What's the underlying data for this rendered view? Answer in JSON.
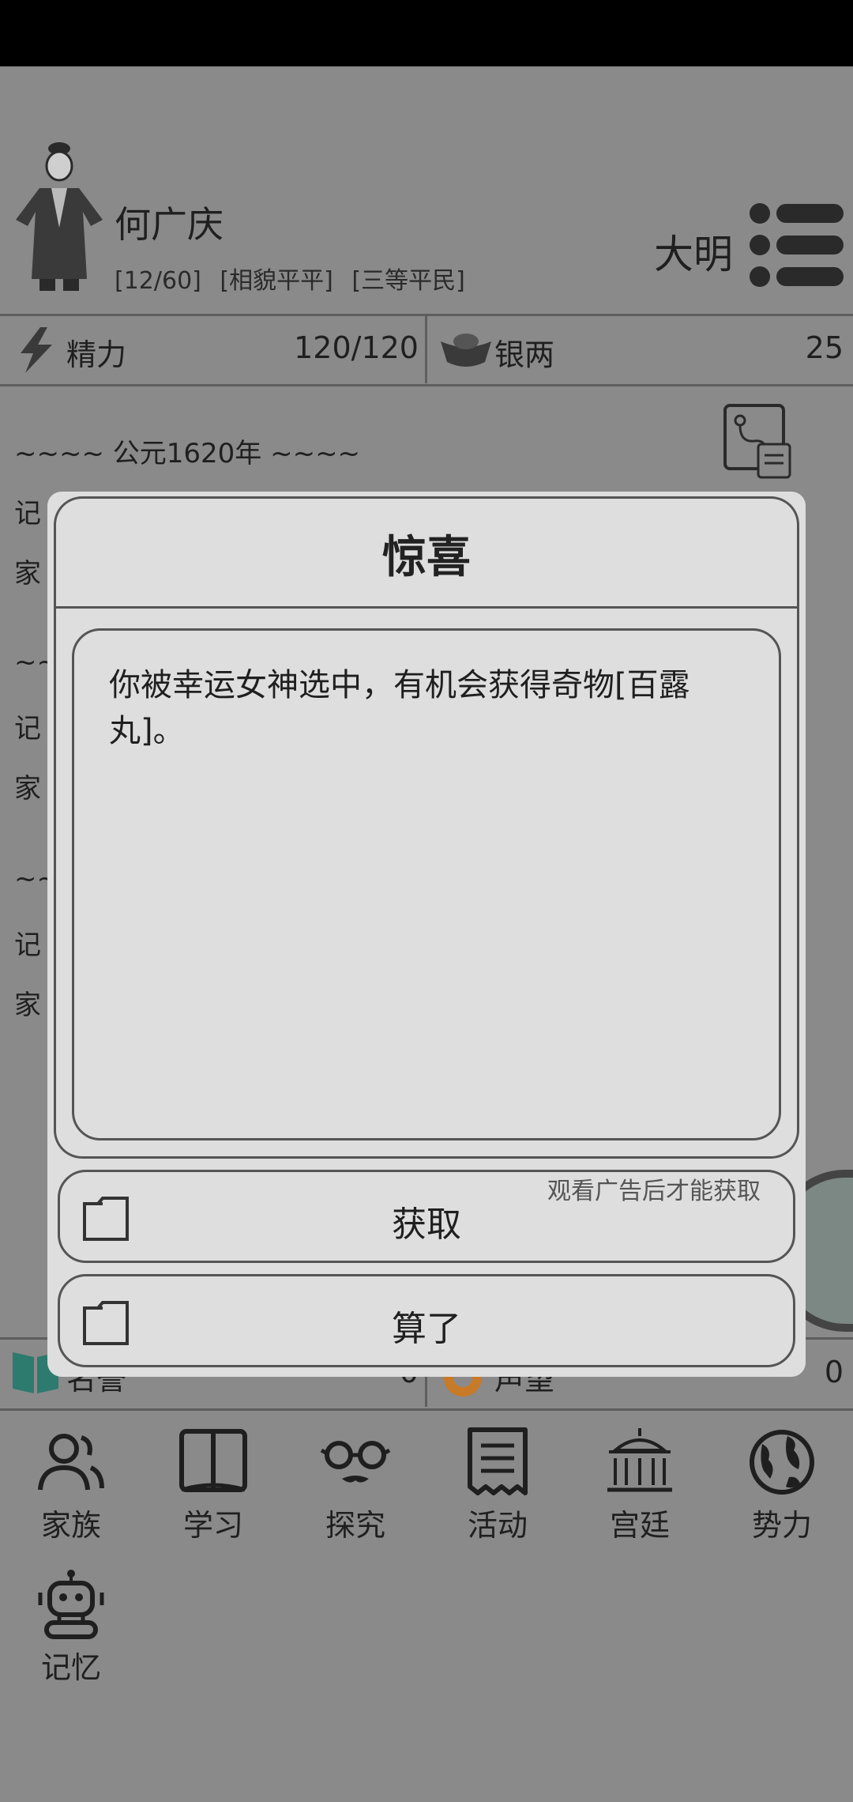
{
  "player": {
    "name": "何广庆",
    "tags": [
      "[12/60]",
      "[相貌平平]",
      "[三等平民]"
    ],
    "dynasty": "大明"
  },
  "stats": {
    "energy_label": "精力",
    "energy_value": "120/120",
    "silver_label": "银两",
    "silver_value": "25"
  },
  "log": {
    "year_line": "~~~~ 公元1620年 ~~~~",
    "lines": [
      "记",
      "家",
      "~~",
      "记",
      "家",
      "~~",
      "记",
      "家"
    ],
    "map_label": "图鉴"
  },
  "bottom_stats": {
    "fame_label": "名誉",
    "fame_value": "0",
    "prestige_label": "声望",
    "prestige_value": "0"
  },
  "nav": {
    "items": [
      {
        "label": "家族",
        "icon": "people-icon"
      },
      {
        "label": "学习",
        "icon": "book-icon"
      },
      {
        "label": "探究",
        "icon": "glasses-icon"
      },
      {
        "label": "活动",
        "icon": "document-icon"
      },
      {
        "label": "宫廷",
        "icon": "palace-icon"
      },
      {
        "label": "势力",
        "icon": "globe-icon"
      },
      {
        "label": "记忆",
        "icon": "robot-icon"
      }
    ]
  },
  "modal": {
    "title": "惊喜",
    "message": "你被幸运女神选中，有机会获得奇物[百露丸]。",
    "ad_hint": "观看广告后才能获取",
    "accept_label": "获取",
    "decline_label": "算了"
  }
}
